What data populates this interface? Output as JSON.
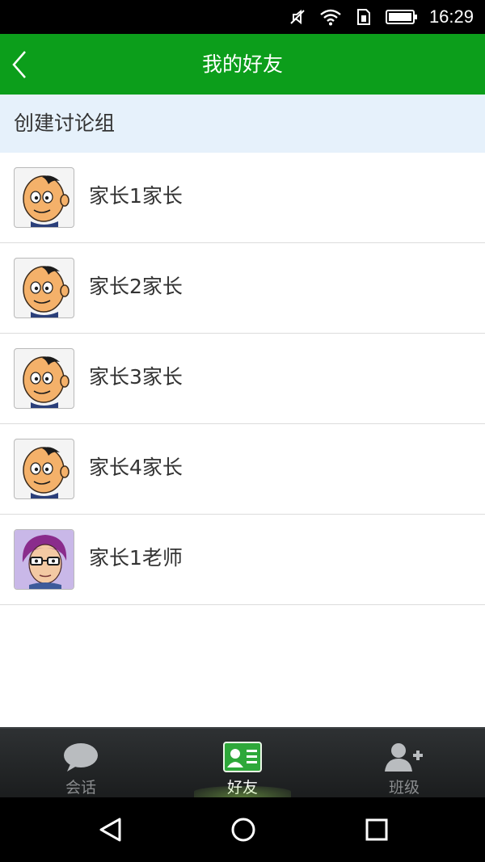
{
  "status_bar": {
    "time": "16:29",
    "icons": [
      "mute-icon",
      "wifi-icon",
      "sim-icon",
      "battery-icon"
    ]
  },
  "header": {
    "title": "我的好友",
    "back_icon": "chevron-left-icon"
  },
  "create_group": {
    "label": "创建讨论组"
  },
  "friends": [
    {
      "name": "家长1家长",
      "avatar": "cartoon-boy-avatar"
    },
    {
      "name": "家长2家长",
      "avatar": "cartoon-boy-avatar"
    },
    {
      "name": "家长3家长",
      "avatar": "cartoon-boy-avatar"
    },
    {
      "name": "家长4家长",
      "avatar": "cartoon-boy-avatar"
    },
    {
      "name": "家长1老师",
      "avatar": "cartoon-teacher-avatar"
    }
  ],
  "tabs": [
    {
      "label": "会话",
      "icon": "chat-bubble-icon",
      "active": false
    },
    {
      "label": "好友",
      "icon": "contact-card-icon",
      "active": true
    },
    {
      "label": "班级",
      "icon": "add-person-icon",
      "active": false
    }
  ],
  "nav_bar": {
    "buttons": [
      "back-triangle-icon",
      "home-circle-icon",
      "recents-square-icon"
    ]
  },
  "colors": {
    "title_bar": "#0c9e1b",
    "create_group_bg": "#e6f1fb",
    "tab_bar": "#232527",
    "active_tab_icon": "#2ea83a"
  }
}
